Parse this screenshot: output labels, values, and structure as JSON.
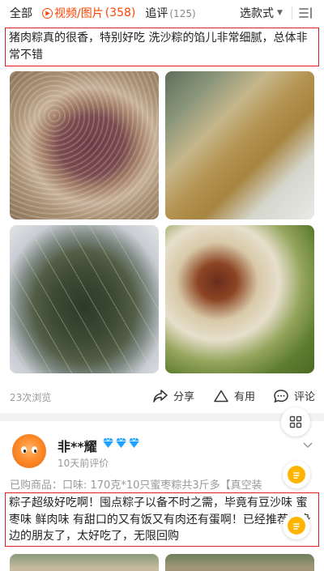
{
  "filter_bar": {
    "all_label": "全部",
    "video_label": "视频/图片",
    "video_count": "(358)",
    "followup_label": "追评",
    "followup_count": "(125)",
    "style_label": "选款式"
  },
  "review1": {
    "text": "猪肉粽真的很香，特别好吃 洗沙粽的馅儿非常细腻，总体非常不错",
    "photos": [
      "pork-zongzi-closeup",
      "bean-paste-zongzi-plate",
      "wrapped-zongzi-plate",
      "date-zongzi-cut"
    ],
    "views": "23次浏览",
    "share_label": "分享",
    "useful_label": "有用",
    "comment_label": "评论"
  },
  "review2": {
    "username": "非**耀",
    "date": "10天前评价",
    "purchased": "已购商品：口味: 170克*10只蜜枣粽共3斤多【真空装",
    "text": "粽子超级好吃啊！囤点粽子以备不时之需，毕竟有豆沙味 蜜枣味 鲜肉味 有甜口的又有饭又有肉还有蛋啊！已经推荐给身边的朋友了，太好吃了，无限回购"
  },
  "colors": {
    "accent": "#ff4400",
    "highlight_border": "#e02020",
    "gem": "#1aa3ff",
    "float_badge": "#ffb400"
  }
}
